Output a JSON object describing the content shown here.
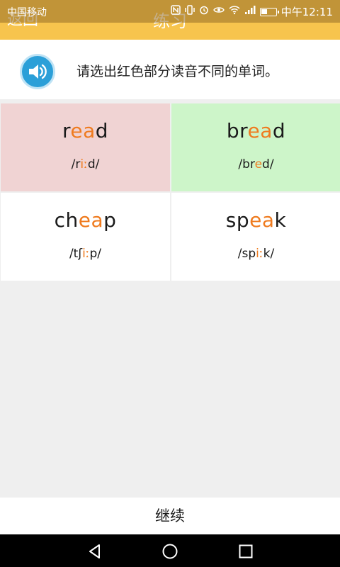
{
  "status_bar": {
    "carrier": "中国移动",
    "time": "中午12:11",
    "icons": [
      "nfc-icon",
      "vibrate-icon",
      "alarm-icon",
      "eye-icon",
      "wifi-icon",
      "signal-icon",
      "battery-icon"
    ]
  },
  "header": {
    "back_label": "返回",
    "title": "练习",
    "color": "#f7c44d"
  },
  "instruction": {
    "text": "请选出红色部分读音不同的单词。",
    "speaker_icon": "speaker-icon"
  },
  "options": [
    {
      "word_pre": "r",
      "word_hl": "ea",
      "word_post": "d",
      "phon_pre": "/r",
      "phon_hl": "iː",
      "phon_post": "d/",
      "state": "wrong"
    },
    {
      "word_pre": "br",
      "word_hl": "ea",
      "word_post": "d",
      "phon_pre": "/br",
      "phon_hl": "e",
      "phon_post": "d/",
      "state": "correct"
    },
    {
      "word_pre": "ch",
      "word_hl": "ea",
      "word_post": "p",
      "phon_pre": "/tʃ",
      "phon_hl": "iː",
      "phon_post": "p/",
      "state": "none"
    },
    {
      "word_pre": "sp",
      "word_hl": "ea",
      "word_post": "k",
      "phon_pre": "/sp",
      "phon_hl": "iː",
      "phon_post": "k/",
      "state": "none"
    }
  ],
  "colors": {
    "highlight": "#ef7b1f",
    "wrong_bg": "#f0d3d3",
    "correct_bg": "#cdf5c9"
  },
  "footer": {
    "continue_label": "继续"
  },
  "nav_bar": {
    "icons": [
      "back-triangle-icon",
      "home-circle-icon",
      "recents-square-icon"
    ]
  }
}
